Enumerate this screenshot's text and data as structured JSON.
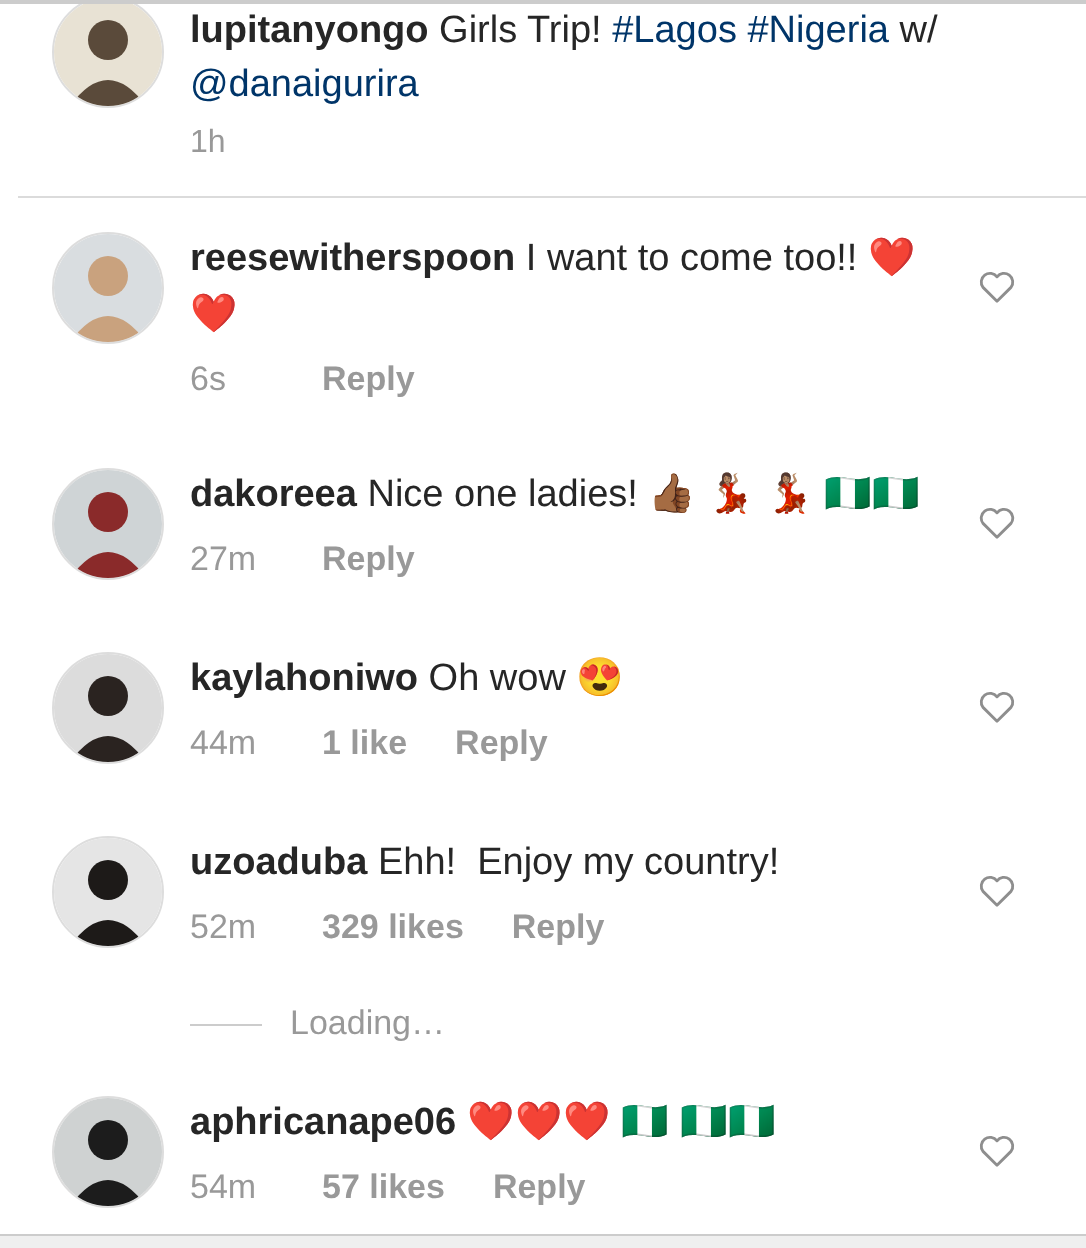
{
  "post": {
    "username": "lupitanyongo",
    "caption": [
      {
        "kind": "text",
        "text": "Girls Trip!"
      },
      {
        "kind": "link",
        "text": "#Lagos"
      },
      {
        "kind": "link",
        "text": "#Nigeria"
      },
      {
        "kind": "text",
        "text": "w/"
      },
      {
        "kind": "link",
        "text": "@danaigurira"
      }
    ],
    "time": "1h"
  },
  "comments": [
    {
      "username": "reesewitherspoon",
      "text": "I want to come too!! ❤️❤️",
      "time": "6s",
      "reply": "Reply",
      "liked": false
    },
    {
      "username": "dakoreea",
      "text": "Nice one ladies! 👍🏾 💃🏽 💃🏽 🇳🇬🇳🇬",
      "time": "27m",
      "reply": "Reply",
      "liked": false
    },
    {
      "username": "kaylahoniwo",
      "text": "Oh wow 😍",
      "time": "44m",
      "likes": "1 like",
      "reply": "Reply",
      "liked": false
    },
    {
      "username": "uzoaduba",
      "text": "Ehh!  Enjoy my country!",
      "time": "52m",
      "likes": "329 likes",
      "reply": "Reply",
      "liked": false
    }
  ],
  "loading": "Loading…",
  "more_comments": [
    {
      "username": "aphricanape06",
      "text": "❤️❤️❤️ 🇳🇬 🇳🇬🇳🇬",
      "time": "54m",
      "likes": "57 likes",
      "reply": "Reply",
      "liked": false
    }
  ]
}
